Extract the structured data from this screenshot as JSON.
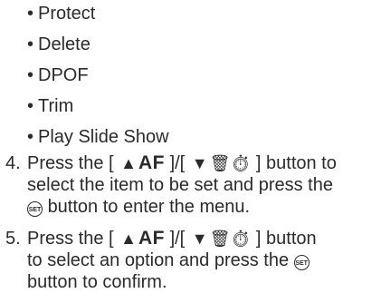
{
  "menu_options": [
    "Protect",
    "Delete",
    "DPOF",
    "Trim",
    "Play Slide Show"
  ],
  "bullet": "•",
  "glyphs": {
    "up_triangle": "▲",
    "down_triangle": "▼",
    "af": "AF",
    "delete_timer": "⍣̅Ὕ1",
    "set_button": "SET"
  },
  "steps": [
    {
      "number": "4.",
      "line1_prefix": "Press the [",
      "line1_middle": "]/[",
      "line1_suffix": "] button to",
      "line2": "select the item to be set and press the",
      "line3_suffix": "button to enter the menu."
    },
    {
      "number": "5.",
      "line1_prefix": "Press the [",
      "line1_middle": "]/[",
      "line1_suffix": "] button",
      "line2_prefix": "to select an option and press the",
      "line3": "button to confirm."
    }
  ]
}
